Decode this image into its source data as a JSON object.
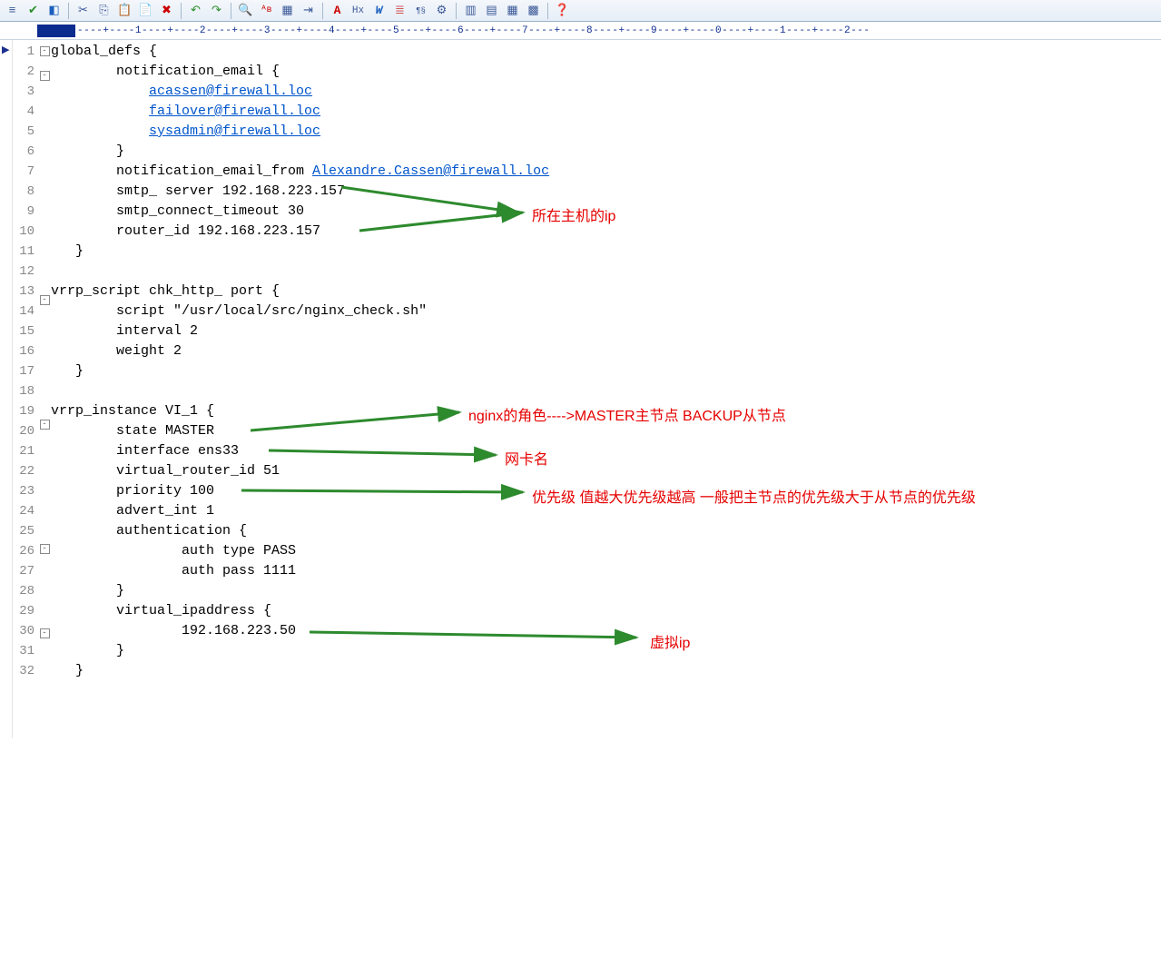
{
  "toolbar": {
    "icons": [
      "list-icon",
      "check-icon",
      "code-icon",
      "cut-icon",
      "copy-icon",
      "paste-icon",
      "paste-special-icon",
      "delete-icon",
      "undo-icon",
      "redo-icon",
      "search-icon",
      "find-replace-icon",
      "highlight-icon",
      "indent-icon",
      "font-icon",
      "hex-icon",
      "wrap-icon",
      "line-icon",
      "symbols-icon",
      "settings-icon",
      "panel1-icon",
      "panel2-icon",
      "panel3-icon",
      "panel4-icon",
      "help-icon"
    ]
  },
  "ruler": {
    "text": "----+----1----+----2----+----3----+----4----+----5----+----6----+----7----+----8----+----9----+----0----+----1----+----2---"
  },
  "lines": [
    {
      "num": "1",
      "fold": "⊟",
      "indent": "",
      "text": "global_defs {"
    },
    {
      "num": "2",
      "fold": "⊟",
      "indent": "        ",
      "text": "notification_email {"
    },
    {
      "num": "3",
      "fold": "",
      "indent": "            ",
      "link": "acassen@firewall.loc"
    },
    {
      "num": "4",
      "fold": "",
      "indent": "            ",
      "link": "failover@firewall.loc"
    },
    {
      "num": "5",
      "fold": "",
      "indent": "            ",
      "link": "sysadmin@firewall.loc"
    },
    {
      "num": "6",
      "fold": "",
      "indent": "        ",
      "text": "}"
    },
    {
      "num": "7",
      "fold": "",
      "indent": "        ",
      "text": "notification_email_from ",
      "link": "Alexandre.Cassen@firewall.loc"
    },
    {
      "num": "8",
      "fold": "",
      "indent": "        ",
      "text": "smtp_ server 192.168.223.157"
    },
    {
      "num": "9",
      "fold": "",
      "indent": "        ",
      "text": "smtp_connect_timeout 30"
    },
    {
      "num": "10",
      "fold": "",
      "indent": "        ",
      "text": "router_id 192.168.223.157"
    },
    {
      "num": "11",
      "fold": "",
      "indent": "   ",
      "text": "}"
    },
    {
      "num": "12",
      "fold": "",
      "indent": "",
      "text": ""
    },
    {
      "num": "13",
      "fold": "⊟",
      "indent": "",
      "text": "vrrp_script chk_http_ port {"
    },
    {
      "num": "14",
      "fold": "",
      "indent": "        ",
      "text": "script \"/usr/local/src/nginx_check.sh\""
    },
    {
      "num": "15",
      "fold": "",
      "indent": "        ",
      "text": "interval 2"
    },
    {
      "num": "16",
      "fold": "",
      "indent": "        ",
      "text": "weight 2"
    },
    {
      "num": "17",
      "fold": "",
      "indent": "   ",
      "text": "}"
    },
    {
      "num": "18",
      "fold": "",
      "indent": "",
      "text": ""
    },
    {
      "num": "19",
      "fold": "⊟",
      "indent": "",
      "text": "vrrp_instance VI_1 {"
    },
    {
      "num": "20",
      "fold": "",
      "indent": "        ",
      "text": "state MASTER"
    },
    {
      "num": "21",
      "fold": "",
      "indent": "        ",
      "text": "interface ens33"
    },
    {
      "num": "22",
      "fold": "",
      "indent": "        ",
      "text": "virtual_router_id 51"
    },
    {
      "num": "23",
      "fold": "",
      "indent": "        ",
      "text": "priority 100"
    },
    {
      "num": "24",
      "fold": "",
      "indent": "        ",
      "text": "advert_int 1"
    },
    {
      "num": "25",
      "fold": "⊟",
      "indent": "        ",
      "text": "authentication {"
    },
    {
      "num": "26",
      "fold": "",
      "indent": "                ",
      "text": "auth type PASS"
    },
    {
      "num": "27",
      "fold": "",
      "indent": "                ",
      "text": "auth pass 1111"
    },
    {
      "num": "28",
      "fold": "",
      "indent": "        ",
      "text": "}"
    },
    {
      "num": "29",
      "fold": "⊟",
      "indent": "        ",
      "text": "virtual_ipaddress {"
    },
    {
      "num": "30",
      "fold": "",
      "indent": "                ",
      "text": "192.168.223.50"
    },
    {
      "num": "31",
      "fold": "",
      "indent": "        ",
      "text": "}"
    },
    {
      "num": "32",
      "fold": "",
      "indent": "   ",
      "text": "}"
    }
  ],
  "annotations": {
    "host_ip": "所在主机的ip",
    "nginx_role": "nginx的角色---->MASTER主节点   BACKUP从节点",
    "nic_name": "网卡名",
    "priority": "优先级  值越大优先级越高 一般把主节点的优先级大于从节点的优先级",
    "virtual_ip": "虚拟ip"
  }
}
